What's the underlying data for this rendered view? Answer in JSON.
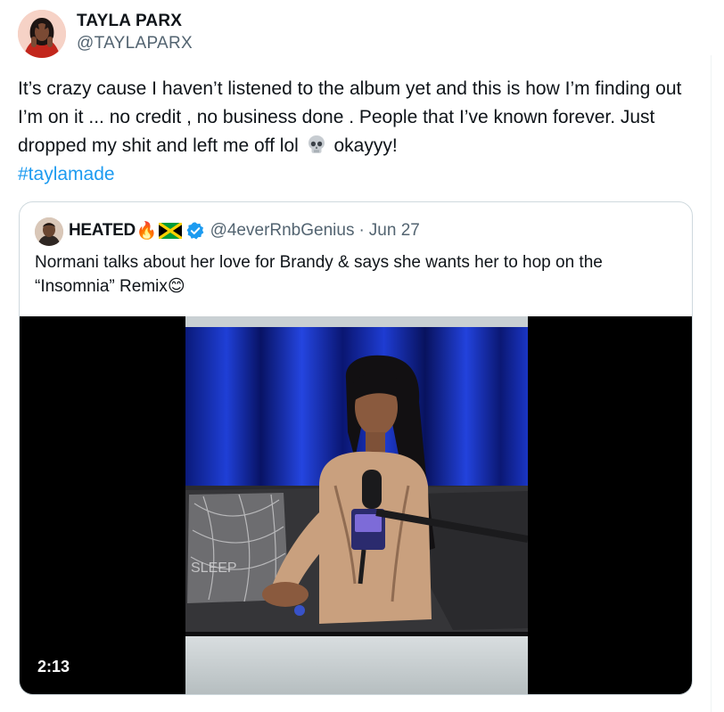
{
  "tweet": {
    "author": {
      "name": "TAYLA PARX",
      "handle": "@TAYLAPARX"
    },
    "text_part1": "It’s crazy cause I haven’t listened to the album yet and this is how I’m finding out I’m on it ... no credit , no business done . People that I’ve known forever. Just dropped my shit and left me off lol ",
    "skull_icon": "skull-emoji-icon",
    "text_part2": " okayyy!",
    "hashtag": "#taylamade"
  },
  "quoted_tweet": {
    "author": {
      "name": "HEATED",
      "name_emojis": "🔥",
      "flag_icon": "jamaica-flag-icon",
      "verified_icon": "verified-badge-icon",
      "handle": "@4everRnbGenius",
      "separator": "·",
      "date": "Jun 27"
    },
    "text": "Normani talks about her love for Brandy & says she wants her to hop on the “Insomnia” Remix",
    "text_emoji": "😊",
    "media": {
      "duration": "2:13",
      "pillow_text": "SLEEP"
    }
  },
  "colors": {
    "text": "#0f1419",
    "secondary": "#536471",
    "link": "#1d9bf0",
    "border": "#cfd9de"
  }
}
